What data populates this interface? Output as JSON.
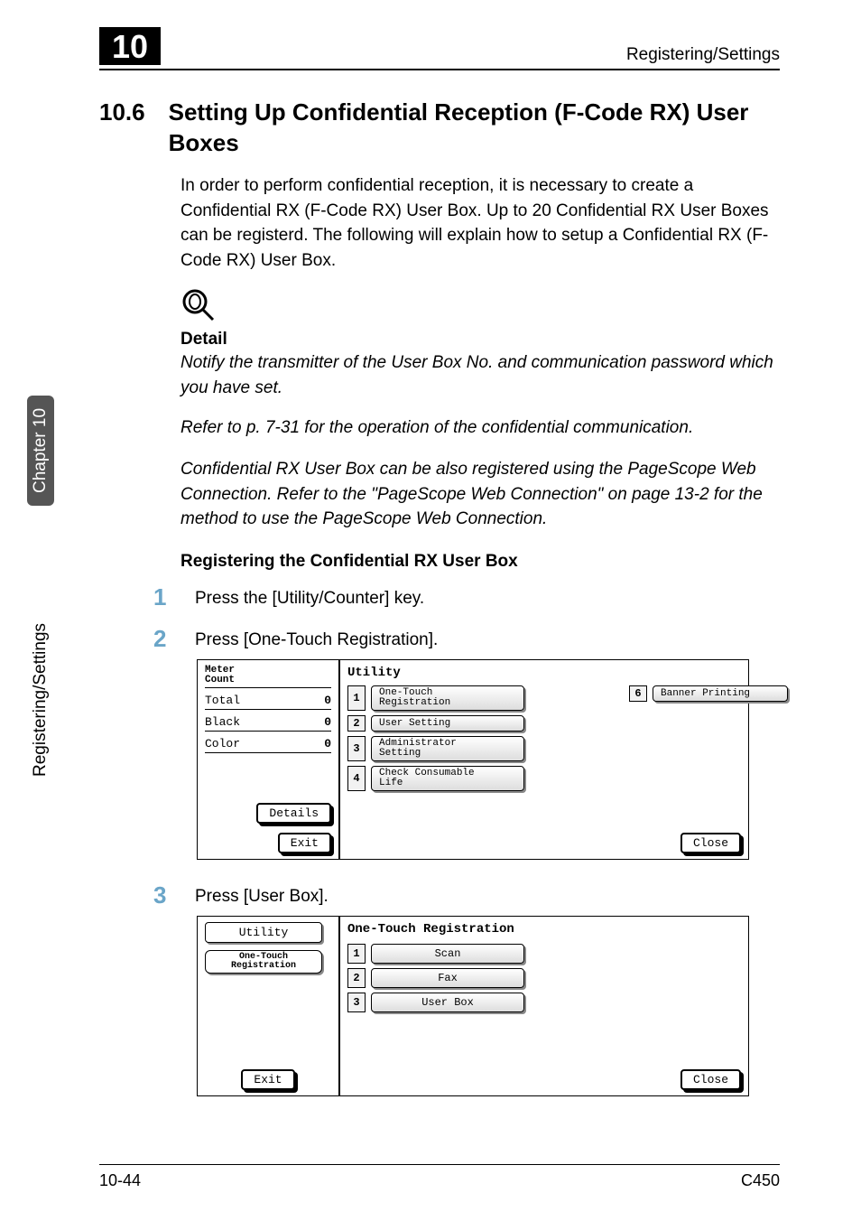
{
  "header": {
    "chapter_box": "10",
    "title": "Registering/Settings"
  },
  "sidetab": {
    "chapter_label": "Chapter 10",
    "section_label": "Registering/Settings"
  },
  "section": {
    "number": "10.6",
    "title": "Setting Up Confidential Reception (F-Code RX) User Boxes"
  },
  "intro": "In order to perform confidential reception, it is necessary to create a Confidential RX (F-Code RX) User Box. Up to 20 Confidential RX User Boxes can be registerd. The following will explain how to setup a Confidential RX (F-Code RX) User Box.",
  "detail": {
    "head": "Detail",
    "p1": "Notify the transmitter of the User Box No. and communication password which you have set.",
    "p2": "Refer to p. 7-31 for the operation of the confidential communication.",
    "p3": "Confidential RX User Box can be also registered using the PageScope Web Connection. Refer to the \"PageScope Web Connection\" on page 13-2 for the method to use the PageScope Web Connection."
  },
  "subhead": "Registering the Confidential RX User Box",
  "steps": {
    "s1_num": "1",
    "s1_text": "Press the [Utility/Counter] key.",
    "s2_num": "2",
    "s2_text": "Press [One-Touch Registration].",
    "s3_num": "3",
    "s3_text": "Press [User Box]."
  },
  "shot1": {
    "left": {
      "meter_head": "Meter\nCount",
      "rows": [
        {
          "label": "Total",
          "value": "0"
        },
        {
          "label": "Black",
          "value": "0"
        },
        {
          "label": "Color",
          "value": "0"
        }
      ],
      "details_btn": "Details",
      "exit_btn": "Exit"
    },
    "right": {
      "title": "Utility",
      "rows": [
        {
          "num": "1",
          "label_l1": "One-Touch",
          "label_l2": "Registration"
        },
        {
          "num": "2",
          "label": "User Setting"
        },
        {
          "num": "3",
          "label_l1": "Administrator",
          "label_l2": "Setting"
        },
        {
          "num": "4",
          "label_l1": "Check Consumable",
          "label_l2": "Life"
        }
      ],
      "col2": {
        "num": "6",
        "label": "Banner Printing"
      },
      "close_btn": "Close"
    }
  },
  "shot2": {
    "left": {
      "utility_btn": "Utility",
      "otr_l1": "One-Touch",
      "otr_l2": "Registration",
      "exit_btn": "Exit"
    },
    "right": {
      "title": "One-Touch Registration",
      "rows": [
        {
          "num": "1",
          "label": "Scan"
        },
        {
          "num": "2",
          "label": "Fax"
        },
        {
          "num": "3",
          "label": "User Box"
        }
      ],
      "close_btn": "Close"
    }
  },
  "footer": {
    "left": "10-44",
    "right": "C450"
  }
}
